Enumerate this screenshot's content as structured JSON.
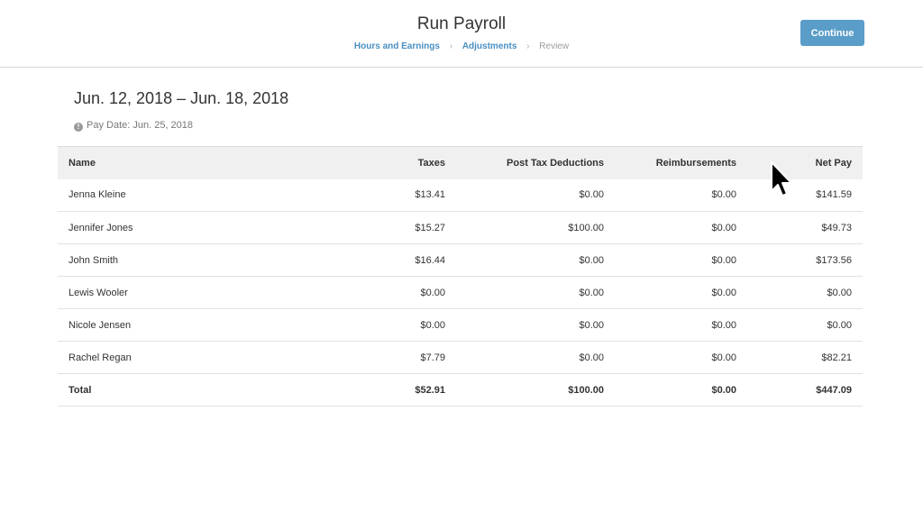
{
  "header": {
    "title": "Run Payroll",
    "steps": [
      "Hours and Earnings",
      "Adjustments",
      "Review"
    ],
    "continue_label": "Continue"
  },
  "period": {
    "title": "Jun. 12, 2018 – Jun. 18, 2018",
    "pay_date": "Pay Date: Jun. 25, 2018"
  },
  "table": {
    "columns": [
      "Name",
      "Taxes",
      "Post Tax Deductions",
      "Reimbursements",
      "Net Pay"
    ],
    "rows": [
      {
        "name": "Jenna Kleine",
        "taxes": "$13.41",
        "post_tax_deductions": "$0.00",
        "reimbursements": "$0.00",
        "net_pay": "$141.59"
      },
      {
        "name": "Jennifer Jones",
        "taxes": "$15.27",
        "post_tax_deductions": "$100.00",
        "reimbursements": "$0.00",
        "net_pay": "$49.73"
      },
      {
        "name": "John Smith",
        "taxes": "$16.44",
        "post_tax_deductions": "$0.00",
        "reimbursements": "$0.00",
        "net_pay": "$173.56"
      },
      {
        "name": "Lewis Wooler",
        "taxes": "$0.00",
        "post_tax_deductions": "$0.00",
        "reimbursements": "$0.00",
        "net_pay": "$0.00"
      },
      {
        "name": "Nicole Jensen",
        "taxes": "$0.00",
        "post_tax_deductions": "$0.00",
        "reimbursements": "$0.00",
        "net_pay": "$0.00"
      },
      {
        "name": "Rachel Regan",
        "taxes": "$7.79",
        "post_tax_deductions": "$0.00",
        "reimbursements": "$0.00",
        "net_pay": "$82.21"
      }
    ],
    "total": {
      "label": "Total",
      "taxes": "$52.91",
      "post_tax_deductions": "$100.00",
      "reimbursements": "$0.00",
      "net_pay": "$447.09"
    }
  },
  "colors": {
    "accent": "#4a8fc2",
    "button": "#5a9dc9",
    "header_row_bg": "#f0f0f0"
  },
  "icons": {
    "info": "info-icon",
    "cursor": "mouse-pointer-icon"
  }
}
